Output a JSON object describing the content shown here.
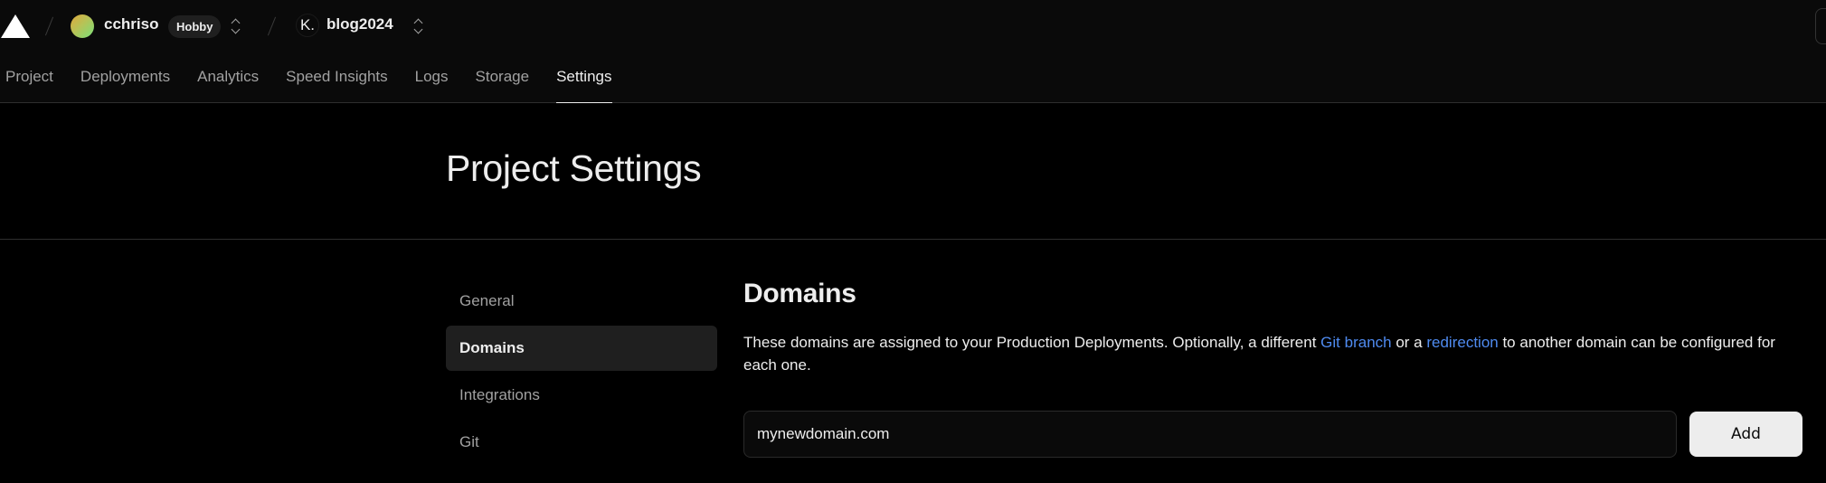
{
  "header": {
    "logo": "vercel-triangle-logo",
    "team": {
      "name": "cchriso",
      "plan_badge": "Hobby"
    },
    "project": {
      "icon_letter": "K.",
      "name": "blog2024"
    }
  },
  "tabs": [
    {
      "label": "Project",
      "active": false
    },
    {
      "label": "Deployments",
      "active": false
    },
    {
      "label": "Analytics",
      "active": false
    },
    {
      "label": "Speed Insights",
      "active": false
    },
    {
      "label": "Logs",
      "active": false
    },
    {
      "label": "Storage",
      "active": false
    },
    {
      "label": "Settings",
      "active": true
    }
  ],
  "page": {
    "title": "Project Settings"
  },
  "sidebar": {
    "items": [
      {
        "label": "General",
        "active": false
      },
      {
        "label": "Domains",
        "active": true
      },
      {
        "label": "Integrations",
        "active": false
      },
      {
        "label": "Git",
        "active": false
      }
    ]
  },
  "domains": {
    "title": "Domains",
    "description_part1": "These domains are assigned to your Production Deployments. Optionally, a different ",
    "link_git_branch": "Git branch",
    "description_part2": " or a ",
    "link_redirection": "redirection",
    "description_part3": " to another domain can be configured for each one.",
    "input_value": "mynewdomain.com",
    "add_button_label": "Add"
  },
  "colors": {
    "background": "#000000",
    "header_bg": "#0a0a0a",
    "link": "#4f8bf0",
    "text_primary": "#ededed",
    "text_secondary": "#a1a1a1",
    "active_item_bg": "#1f1f1f"
  }
}
